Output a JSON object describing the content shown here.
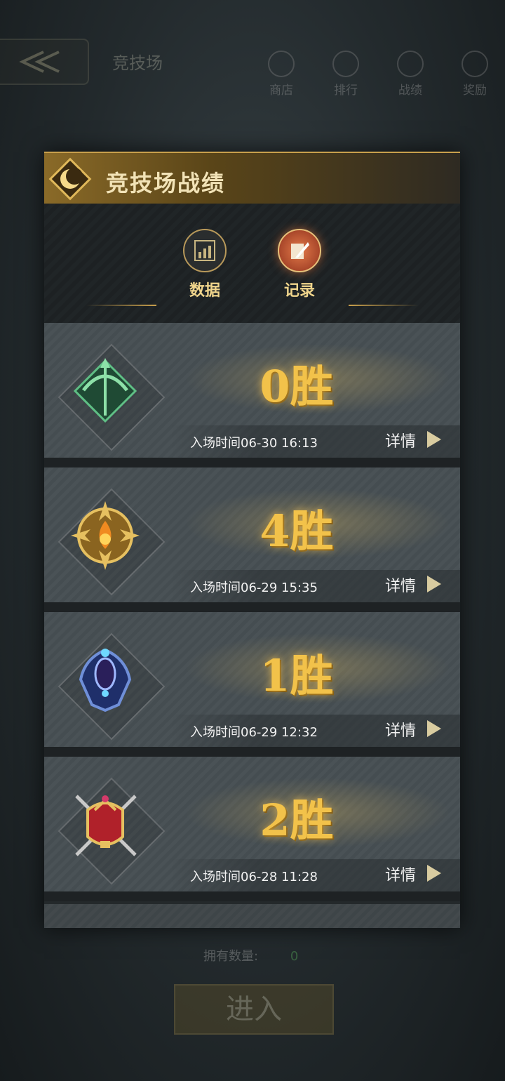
{
  "background": {
    "back_label": "",
    "screen_title": "竞技场",
    "nav": [
      "商店",
      "排行",
      "战绩",
      "奖励"
    ],
    "own_count_label": "拥有数量:",
    "own_count_value": "0",
    "enter_label": "进入"
  },
  "panel": {
    "title": "竞技场战绩",
    "tabs": [
      {
        "label": "数据",
        "active": false,
        "icon": "chart-icon"
      },
      {
        "label": "记录",
        "active": true,
        "icon": "quill-icon"
      }
    ],
    "records": [
      {
        "wins": "0胜",
        "time": "入场时间06-30 16:13",
        "detail": "详情",
        "badge": "green-bow-badge-icon"
      },
      {
        "wins": "4胜",
        "time": "入场时间06-29 15:35",
        "detail": "详情",
        "badge": "gold-flame-badge-icon"
      },
      {
        "wins": "1胜",
        "time": "入场时间06-29 12:32",
        "detail": "详情",
        "badge": "blue-crest-badge-icon"
      },
      {
        "wins": "2胜",
        "time": "入场时间06-28 11:28",
        "detail": "详情",
        "badge": "red-crown-badge-icon"
      }
    ]
  },
  "colors": {
    "accent_gold": "#f2c24a",
    "header_gold": "#8a6a28",
    "tab_active": "#e27a4a"
  }
}
